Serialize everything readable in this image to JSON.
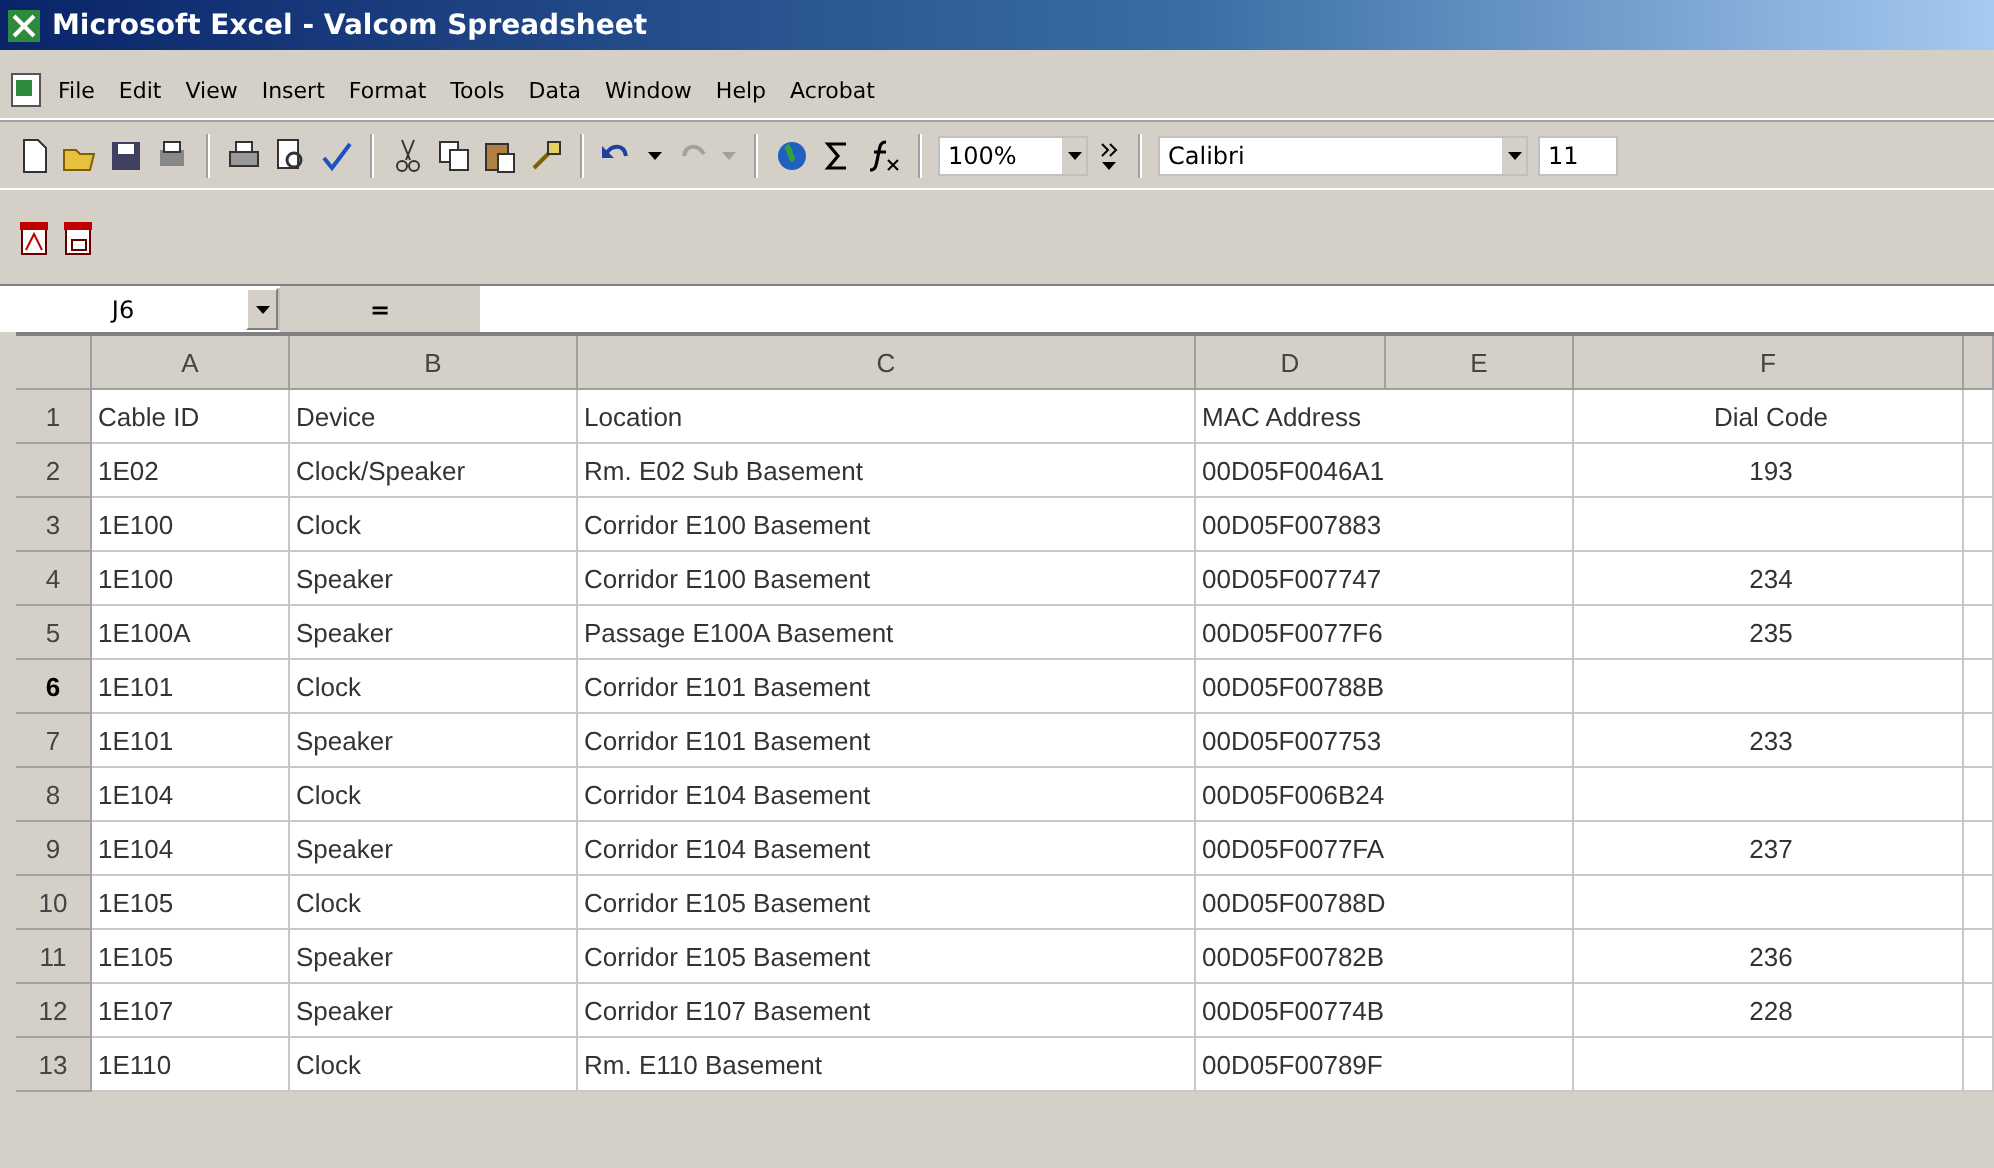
{
  "window": {
    "title": "Microsoft Excel - Valcom Spreadsheet"
  },
  "menu": [
    "File",
    "Edit",
    "View",
    "Insert",
    "Format",
    "Tools",
    "Data",
    "Window",
    "Help",
    "Acrobat"
  ],
  "toolbar": {
    "zoom": "100%",
    "font": "Calibri",
    "font_size": "11"
  },
  "formula_bar": {
    "name_box": "J6",
    "equals": "="
  },
  "sheet": {
    "columns": [
      "A",
      "B",
      "C",
      "D",
      "E",
      "F"
    ],
    "rows": [
      {
        "number": "1",
        "selected": false,
        "cells": [
          "Cable ID",
          "Device",
          "Location",
          "MAC Address",
          "Dial Code"
        ]
      },
      {
        "number": "2",
        "selected": false,
        "cells": [
          "1E02",
          "Clock/Speaker",
          "Rm. E02 Sub Basement",
          "00D05F0046A1",
          "193"
        ]
      },
      {
        "number": "3",
        "selected": false,
        "cells": [
          "1E100",
          "Clock",
          "Corridor E100 Basement",
          "00D05F007883"
        ]
      },
      {
        "number": "4",
        "selected": false,
        "cells": [
          "1E100",
          "Speaker",
          "Corridor E100 Basement",
          "00D05F007747",
          "234"
        ]
      },
      {
        "number": "5",
        "selected": false,
        "cells": [
          "1E100A",
          "Speaker",
          "Passage E100A Basement",
          "00D05F0077F6",
          "235"
        ]
      },
      {
        "number": "6",
        "selected": true,
        "cells": [
          "1E101",
          "Clock",
          "Corridor E101 Basement",
          "00D05F00788B"
        ]
      },
      {
        "number": "7",
        "selected": false,
        "cells": [
          "1E101",
          "Speaker",
          "Corridor E101 Basement",
          "00D05F007753",
          "233"
        ]
      },
      {
        "number": "8",
        "selected": false,
        "cells": [
          "1E104",
          "Clock",
          "Corridor E104 Basement",
          "00D05F006B24"
        ]
      },
      {
        "number": "9",
        "selected": false,
        "cells": [
          "1E104",
          "Speaker",
          "Corridor E104 Basement",
          "00D05F0077FA",
          "237"
        ]
      },
      {
        "number": "10",
        "selected": false,
        "cells": [
          "1E105",
          "Clock",
          "Corridor E105 Basement",
          "00D05F00788D"
        ]
      },
      {
        "number": "11",
        "selected": false,
        "cells": [
          "1E105",
          "Speaker",
          "Corridor E105 Basement",
          "00D05F00782B",
          "236"
        ]
      },
      {
        "number": "12",
        "selected": false,
        "cells": [
          "1E107",
          "Speaker",
          "Corridor E107 Basement",
          "00D05F00774B",
          "228"
        ]
      },
      {
        "number": "13",
        "selected": false,
        "cells": [
          "1E110",
          "Clock",
          "Rm. E110 Basement",
          "00D05F00789F"
        ]
      }
    ]
  }
}
